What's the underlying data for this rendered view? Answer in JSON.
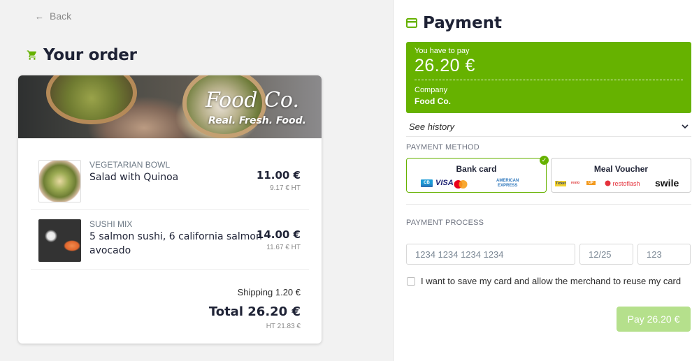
{
  "nav": {
    "back_label": "Back"
  },
  "order": {
    "title": "Your order",
    "banner": {
      "brand": "Food Co.",
      "tagline": "Real. Fresh. Food."
    },
    "items": [
      {
        "category": "VEGETARIAN BOWL",
        "name": "Salad with Quinoa",
        "price": "11.00 €",
        "ht": "9.17 € HT"
      },
      {
        "category": "SUSHI MIX",
        "name_line1": "5 salmon sushi, 6 california salmon",
        "name_line2": "avocado",
        "price": "14.00 €",
        "ht": "11.67 € HT"
      }
    ],
    "shipping": "Shipping 1.20 €",
    "total": "Total 26.20 €",
    "total_ht": "HT 21.83 €"
  },
  "payment": {
    "title": "Payment",
    "summary": {
      "pay_label": "You have to pay",
      "amount": "26.20 €",
      "company_label": "Company",
      "company": "Food Co."
    },
    "history_label": "See history",
    "method_label": "PAYMENT METHOD",
    "methods": [
      {
        "name": "Bank card",
        "logos": [
          "CB",
          "VISA",
          "mastercard",
          "AMERICAN",
          "EXPRESS"
        ]
      },
      {
        "name": "Meal Voucher",
        "logos": [
          "Ticket",
          "resto",
          "UP",
          "restoflash",
          "swile"
        ]
      }
    ],
    "process_label": "PAYMENT PROCESS",
    "inputs": {
      "card_number_placeholder": "1234 1234 1234 1234",
      "expiry_placeholder": "12/25",
      "cvc_placeholder": "123"
    },
    "save_card_label": "I want to save my card and allow the merchand to reuse my card",
    "pay_button": "Pay 26.20 €"
  },
  "colors": {
    "accent": "#66b200",
    "pay_button_disabled": "#b5e08c",
    "title_text": "#1e2235"
  },
  "icons": [
    "arrow-left-icon",
    "cart-icon",
    "credit-card-icon",
    "chevron-down-icon",
    "check-icon"
  ]
}
